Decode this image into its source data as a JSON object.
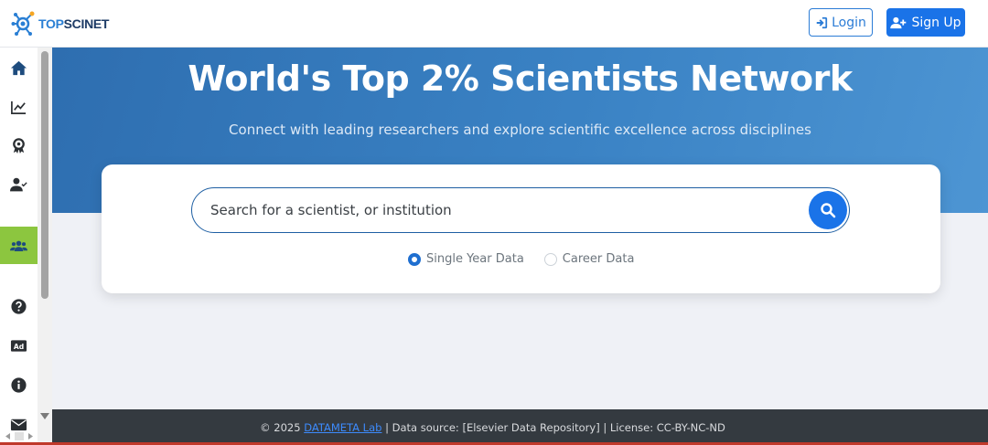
{
  "brand": {
    "logo_part1": "TOP",
    "logo_part2": "SCINET",
    "icon": "network-node-logo"
  },
  "header": {
    "login_label": "Login",
    "signup_label": "Sign Up"
  },
  "sidebar": {
    "items": [
      {
        "name": "home",
        "icon": "home-icon",
        "active": false
      },
      {
        "name": "analytics",
        "icon": "chart-line-icon",
        "active": false
      },
      {
        "name": "awards",
        "icon": "award-icon",
        "active": false
      },
      {
        "name": "verified-user",
        "icon": "user-check-icon",
        "active": false
      },
      {
        "name": "network",
        "icon": "users-icon",
        "active": true
      },
      {
        "name": "help",
        "icon": "question-circle-icon",
        "active": false
      },
      {
        "name": "ads",
        "icon": "ad-icon",
        "active": false
      },
      {
        "name": "info",
        "icon": "info-circle-icon",
        "active": false
      },
      {
        "name": "contact",
        "icon": "envelope-icon",
        "active": false
      }
    ]
  },
  "hero": {
    "title": "World's Top 2% Scientists Network",
    "subtitle": "Connect with leading researchers and explore scientific excellence across disciplines"
  },
  "search": {
    "placeholder": "Search for a scientist, or institution",
    "options": [
      {
        "label": "Single Year Data",
        "selected": true
      },
      {
        "label": "Career Data",
        "selected": false
      }
    ]
  },
  "footer": {
    "copyright": "© 2025",
    "lab_link": "DATAMETA Lab",
    "rest": "| Data source: [Elsevier Data Repository] | License: CC-BY-NC-ND"
  },
  "colors": {
    "primary": "#1a73e8",
    "accent_green": "#8cc63f",
    "hero_blue": "#3a82c4",
    "footer_dark": "#343a40"
  }
}
